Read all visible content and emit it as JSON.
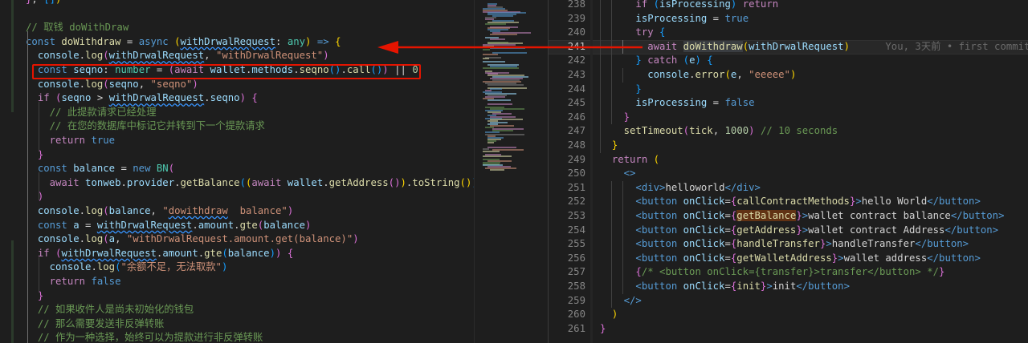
{
  "blame": "You, 3天前 • first commit",
  "colors": {
    "background": "#1e1e1e",
    "annotation_red": "#e51400",
    "keyword": "#569cd6",
    "function": "#dcdcaa",
    "string": "#ce9178",
    "comment": "#6a9955"
  },
  "left_lines": [
    [
      [
        "}",
        "br2"
      ],
      [
        ", ",
        ""
      ],
      [
        "[]",
        "br3"
      ],
      [
        ")",
        "br1"
      ]
    ],
    [],
    [
      [
        "// 取钱 doWithDraw",
        "cmt"
      ]
    ],
    [
      [
        "const ",
        "kw"
      ],
      [
        "doWithdraw",
        "fn"
      ],
      [
        " = ",
        ""
      ],
      [
        "async",
        "kw"
      ],
      [
        " ",
        ""
      ],
      [
        "(",
        "br1"
      ],
      [
        "withDrwalRequest",
        "var squig"
      ],
      [
        ": ",
        ""
      ],
      [
        "any",
        "type"
      ],
      [
        ")",
        "br1"
      ],
      [
        " ",
        ""
      ],
      [
        "=>",
        "kw"
      ],
      [
        " ",
        ""
      ],
      [
        "{",
        "br1"
      ]
    ],
    [
      [
        "  ",
        ""
      ],
      [
        "console",
        "var"
      ],
      [
        ".",
        ""
      ],
      [
        "log",
        "fn"
      ],
      [
        "(",
        "br2"
      ],
      [
        "withDrwalRequest",
        "var squig"
      ],
      [
        ", ",
        ""
      ],
      [
        "\"withDrwalRequest\"",
        "str"
      ],
      [
        ")",
        "br2"
      ]
    ],
    [
      [
        "  ",
        ""
      ],
      [
        "const ",
        "kw"
      ],
      [
        "seqno",
        "var"
      ],
      [
        ": ",
        ""
      ],
      [
        "number",
        "type"
      ],
      [
        " = ",
        ""
      ],
      [
        "(",
        "br2"
      ],
      [
        "await ",
        "ctl"
      ],
      [
        "wallet",
        "var"
      ],
      [
        ".",
        ""
      ],
      [
        "methods",
        "var"
      ],
      [
        ".",
        ""
      ],
      [
        "seqno",
        "fn"
      ],
      [
        "(",
        "br3"
      ],
      [
        ")",
        "br3"
      ],
      [
        ".",
        ""
      ],
      [
        "call",
        "fn"
      ],
      [
        "(",
        "br3"
      ],
      [
        ")",
        "br3"
      ],
      [
        ")",
        "br2"
      ],
      [
        " || ",
        ""
      ],
      [
        "0",
        "num"
      ]
    ],
    [
      [
        "  ",
        ""
      ],
      [
        "console",
        "var"
      ],
      [
        ".",
        ""
      ],
      [
        "log",
        "fn"
      ],
      [
        "(",
        "br2"
      ],
      [
        "seqno",
        "var"
      ],
      [
        ", ",
        ""
      ],
      [
        "\"seqno\"",
        "str"
      ],
      [
        ")",
        "br2"
      ]
    ],
    [
      [
        "  ",
        ""
      ],
      [
        "if ",
        "ctl"
      ],
      [
        "(",
        "br2"
      ],
      [
        "seqno",
        "var"
      ],
      [
        " > ",
        ""
      ],
      [
        "withDrwalRequest",
        "var squig"
      ],
      [
        ".",
        ""
      ],
      [
        "seqno",
        "var"
      ],
      [
        ")",
        "br2"
      ],
      [
        " ",
        ""
      ],
      [
        "{",
        "br2"
      ]
    ],
    [
      [
        "    ",
        ""
      ],
      [
        "// 此提款请求已经处理",
        "cmt"
      ]
    ],
    [
      [
        "    ",
        ""
      ],
      [
        "// 在您的数据库中标记它并转到下一个提款请求",
        "cmt"
      ]
    ],
    [
      [
        "    ",
        ""
      ],
      [
        "return ",
        "ctl"
      ],
      [
        "true",
        "kw"
      ]
    ],
    [
      [
        "  ",
        ""
      ],
      [
        "}",
        "br2"
      ]
    ],
    [
      [
        "  ",
        ""
      ],
      [
        "const ",
        "kw"
      ],
      [
        "balance",
        "var"
      ],
      [
        " = ",
        ""
      ],
      [
        "new ",
        "kw"
      ],
      [
        "BN",
        "type"
      ],
      [
        "(",
        "br2"
      ]
    ],
    [
      [
        "    ",
        ""
      ],
      [
        "await ",
        "ctl"
      ],
      [
        "tonweb",
        "var"
      ],
      [
        ".",
        ""
      ],
      [
        "provider",
        "var"
      ],
      [
        ".",
        ""
      ],
      [
        "getBalance",
        "fn"
      ],
      [
        "(",
        "br3"
      ],
      [
        "(",
        "br1"
      ],
      [
        "await ",
        "ctl"
      ],
      [
        "wallet",
        "var"
      ],
      [
        ".",
        ""
      ],
      [
        "getAddress",
        "fn"
      ],
      [
        "(",
        "br2"
      ],
      [
        ")",
        "br2"
      ],
      [
        ")",
        "br1"
      ],
      [
        ".",
        ""
      ],
      [
        "toString",
        "fn"
      ],
      [
        "(",
        "br1"
      ],
      [
        ")",
        "br1"
      ],
      [
        ")",
        "br3"
      ]
    ],
    [
      [
        "  ",
        ""
      ],
      [
        ")",
        "br2"
      ]
    ],
    [
      [
        "  ",
        ""
      ],
      [
        "console",
        "var"
      ],
      [
        ".",
        ""
      ],
      [
        "log",
        "fn"
      ],
      [
        "(",
        "br2"
      ],
      [
        "balance",
        "var"
      ],
      [
        ", ",
        ""
      ],
      [
        "\"",
        "str"
      ],
      [
        "dowithdraw",
        "str squig"
      ],
      [
        "  balance\"",
        "str"
      ],
      [
        ")",
        "br2"
      ]
    ],
    [
      [
        "  ",
        ""
      ],
      [
        "const ",
        "kw"
      ],
      [
        "a",
        "var"
      ],
      [
        " = ",
        ""
      ],
      [
        "withDrwalRequest",
        "var squig"
      ],
      [
        ".",
        ""
      ],
      [
        "amount",
        "var"
      ],
      [
        ".",
        ""
      ],
      [
        "gte",
        "fn"
      ],
      [
        "(",
        "br2"
      ],
      [
        "balance",
        "var"
      ],
      [
        ")",
        "br2"
      ]
    ],
    [
      [
        "  ",
        ""
      ],
      [
        "console",
        "var"
      ],
      [
        ".",
        ""
      ],
      [
        "log",
        "fn"
      ],
      [
        "(",
        "br2"
      ],
      [
        "a",
        "var"
      ],
      [
        ", ",
        ""
      ],
      [
        "\"withDrwalRequest.amount.get(balance)\"",
        "str"
      ],
      [
        ")",
        "br2"
      ]
    ],
    [
      [
        "  ",
        ""
      ],
      [
        "if ",
        "ctl"
      ],
      [
        "(",
        "br2"
      ],
      [
        "withDrwalRequest",
        "var squig"
      ],
      [
        ".",
        ""
      ],
      [
        "amount",
        "var"
      ],
      [
        ".",
        ""
      ],
      [
        "gte",
        "fn"
      ],
      [
        "(",
        "br3"
      ],
      [
        "balance",
        "var"
      ],
      [
        ")",
        "br3"
      ],
      [
        ")",
        "br2"
      ],
      [
        " ",
        ""
      ],
      [
        "{",
        "br2"
      ]
    ],
    [
      [
        "    ",
        ""
      ],
      [
        "console",
        "var"
      ],
      [
        ".",
        ""
      ],
      [
        "log",
        "fn"
      ],
      [
        "(",
        "br3"
      ],
      [
        "\"余额不足，无法取款\"",
        "str"
      ],
      [
        ")",
        "br3"
      ]
    ],
    [
      [
        "    ",
        ""
      ],
      [
        "return ",
        "ctl"
      ],
      [
        "false",
        "kw"
      ]
    ],
    [
      [
        "  ",
        ""
      ],
      [
        "}",
        "br2"
      ]
    ],
    [
      [
        "  ",
        ""
      ],
      [
        "// 如果收件人是尚未初始化的钱包",
        "cmt"
      ]
    ],
    [
      [
        "  ",
        ""
      ],
      [
        "// 那么需要发送非反弹转账",
        "cmt"
      ]
    ],
    [
      [
        "  ",
        ""
      ],
      [
        "// 作为一种选择，始终可以为提款进行非反弹转账",
        "cmt"
      ]
    ]
  ],
  "right_lines": [
    {
      "n": "238",
      "t": [
        [
          "      ",
          ""
        ],
        [
          "if ",
          "ctl"
        ],
        [
          "(",
          "br3"
        ],
        [
          "isProcessing",
          "var"
        ],
        [
          ") ",
          "br3"
        ],
        [
          "return",
          "ctl"
        ]
      ]
    },
    {
      "n": "239",
      "t": [
        [
          "      ",
          ""
        ],
        [
          "isProcessing",
          "var"
        ],
        [
          " = ",
          ""
        ],
        [
          "true",
          "kw"
        ]
      ]
    },
    {
      "n": "240",
      "t": [
        [
          "      ",
          ""
        ],
        [
          "try ",
          "ctl"
        ],
        [
          "{",
          "br3"
        ]
      ]
    },
    {
      "n": "241",
      "t": [
        [
          "        ",
          ""
        ],
        [
          "await ",
          "ctl"
        ],
        [
          "doWithdraw",
          "fn hl-sel"
        ],
        [
          "(",
          "br1"
        ],
        [
          "withDrwalRequest",
          "var"
        ],
        [
          ")",
          "br1"
        ]
      ],
      "current": true
    },
    {
      "n": "242",
      "t": [
        [
          "      ",
          ""
        ],
        [
          "}",
          "br3"
        ],
        [
          " ",
          ""
        ],
        [
          "catch ",
          "ctl"
        ],
        [
          "(",
          "br3"
        ],
        [
          "e",
          "var"
        ],
        [
          ")",
          "br3"
        ],
        [
          " ",
          ""
        ],
        [
          "{",
          "br3"
        ]
      ]
    },
    {
      "n": "243",
      "t": [
        [
          "        ",
          ""
        ],
        [
          "console",
          "var"
        ],
        [
          ".",
          ""
        ],
        [
          "error",
          "fn"
        ],
        [
          "(",
          "br1"
        ],
        [
          "e",
          "var"
        ],
        [
          ", ",
          ""
        ],
        [
          "\"eeeee\"",
          "str"
        ],
        [
          ")",
          "br1"
        ]
      ]
    },
    {
      "n": "244",
      "t": [
        [
          "      ",
          ""
        ],
        [
          "}",
          "br3"
        ]
      ]
    },
    {
      "n": "245",
      "t": [
        [
          "      ",
          ""
        ],
        [
          "isProcessing",
          "var"
        ],
        [
          " = ",
          ""
        ],
        [
          "false",
          "kw"
        ]
      ]
    },
    {
      "n": "246",
      "t": [
        [
          "    ",
          ""
        ],
        [
          "}",
          "br2"
        ]
      ]
    },
    {
      "n": "247",
      "t": [
        [
          "    ",
          ""
        ],
        [
          "setTimeout",
          "fn"
        ],
        [
          "(",
          "br2"
        ],
        [
          "tick",
          "fn"
        ],
        [
          ", ",
          ""
        ],
        [
          "1000",
          "num"
        ],
        [
          ")",
          "br2"
        ],
        [
          " ",
          ""
        ],
        [
          "// 10 seconds",
          "cmt"
        ]
      ]
    },
    {
      "n": "248",
      "t": [
        [
          "  ",
          ""
        ],
        [
          "}",
          "br1"
        ]
      ]
    },
    {
      "n": "249",
      "t": [
        [
          "  ",
          ""
        ],
        [
          "return ",
          "ctl"
        ],
        [
          "(",
          "br1"
        ]
      ]
    },
    {
      "n": "250",
      "t": [
        [
          "    ",
          ""
        ],
        [
          "<>",
          "tag"
        ]
      ]
    },
    {
      "n": "251",
      "t": [
        [
          "      ",
          ""
        ],
        [
          "<div>",
          "tag"
        ],
        [
          "helloworld",
          ""
        ],
        [
          "</div>",
          "tag"
        ]
      ]
    },
    {
      "n": "252",
      "t": [
        [
          "      ",
          ""
        ],
        [
          "<button ",
          "tag"
        ],
        [
          "onClick",
          "var"
        ],
        [
          "=",
          ""
        ],
        [
          "{",
          "br2"
        ],
        [
          "callContractMethods",
          "fn"
        ],
        [
          "}",
          "br2"
        ],
        [
          ">",
          "tag"
        ],
        [
          "hello World",
          ""
        ],
        [
          "</button>",
          "tag"
        ]
      ]
    },
    {
      "n": "253",
      "t": [
        [
          "      ",
          ""
        ],
        [
          "<button ",
          "tag"
        ],
        [
          "onClick",
          "var"
        ],
        [
          "=",
          ""
        ],
        [
          "{",
          "br2"
        ],
        [
          "getBalance",
          "fn hl-word"
        ],
        [
          "}",
          "br2"
        ],
        [
          ">",
          "tag"
        ],
        [
          "wallet contract ballance",
          ""
        ],
        [
          "</button>",
          "tag"
        ]
      ]
    },
    {
      "n": "254",
      "t": [
        [
          "      ",
          ""
        ],
        [
          "<button ",
          "tag"
        ],
        [
          "onClick",
          "var"
        ],
        [
          "=",
          ""
        ],
        [
          "{",
          "br2"
        ],
        [
          "getAddress",
          "fn"
        ],
        [
          "}",
          "br2"
        ],
        [
          ">",
          "tag"
        ],
        [
          "wallet contract Address",
          ""
        ],
        [
          "</button>",
          "tag"
        ]
      ]
    },
    {
      "n": "255",
      "t": [
        [
          "      ",
          ""
        ],
        [
          "<button ",
          "tag"
        ],
        [
          "onClick",
          "var"
        ],
        [
          "=",
          ""
        ],
        [
          "{",
          "br2"
        ],
        [
          "handleTransfer",
          "fn"
        ],
        [
          "}",
          "br2"
        ],
        [
          ">",
          "tag"
        ],
        [
          "handleTransfer",
          ""
        ],
        [
          "</button>",
          "tag"
        ]
      ]
    },
    {
      "n": "256",
      "t": [
        [
          "      ",
          ""
        ],
        [
          "<button ",
          "tag"
        ],
        [
          "onClick",
          "var"
        ],
        [
          "=",
          ""
        ],
        [
          "{",
          "br2"
        ],
        [
          "getWalletAddress",
          "fn"
        ],
        [
          "}",
          "br2"
        ],
        [
          ">",
          "tag"
        ],
        [
          "wallet address",
          ""
        ],
        [
          "</button>",
          "tag"
        ]
      ]
    },
    {
      "n": "257",
      "t": [
        [
          "      ",
          ""
        ],
        [
          "{",
          "br2"
        ],
        [
          "/* <button onClick={transfer}>transfer</button> */",
          "cmt"
        ],
        [
          "}",
          "br2"
        ]
      ]
    },
    {
      "n": "258",
      "t": [
        [
          "      ",
          ""
        ],
        [
          "<button ",
          "tag"
        ],
        [
          "onClick",
          "var"
        ],
        [
          "=",
          ""
        ],
        [
          "{",
          "br2"
        ],
        [
          "init",
          "fn"
        ],
        [
          "}",
          "br2"
        ],
        [
          ">",
          "tag"
        ],
        [
          "init",
          ""
        ],
        [
          "</button>",
          "tag"
        ]
      ]
    },
    {
      "n": "259",
      "t": [
        [
          "    ",
          ""
        ],
        [
          "</>",
          "tag"
        ]
      ]
    },
    {
      "n": "260",
      "t": [
        [
          "  ",
          ""
        ],
        [
          ")",
          "br1"
        ]
      ]
    },
    {
      "n": "261",
      "t": [
        [
          "",
          ""
        ],
        [
          "}",
          "br2"
        ]
      ]
    }
  ]
}
